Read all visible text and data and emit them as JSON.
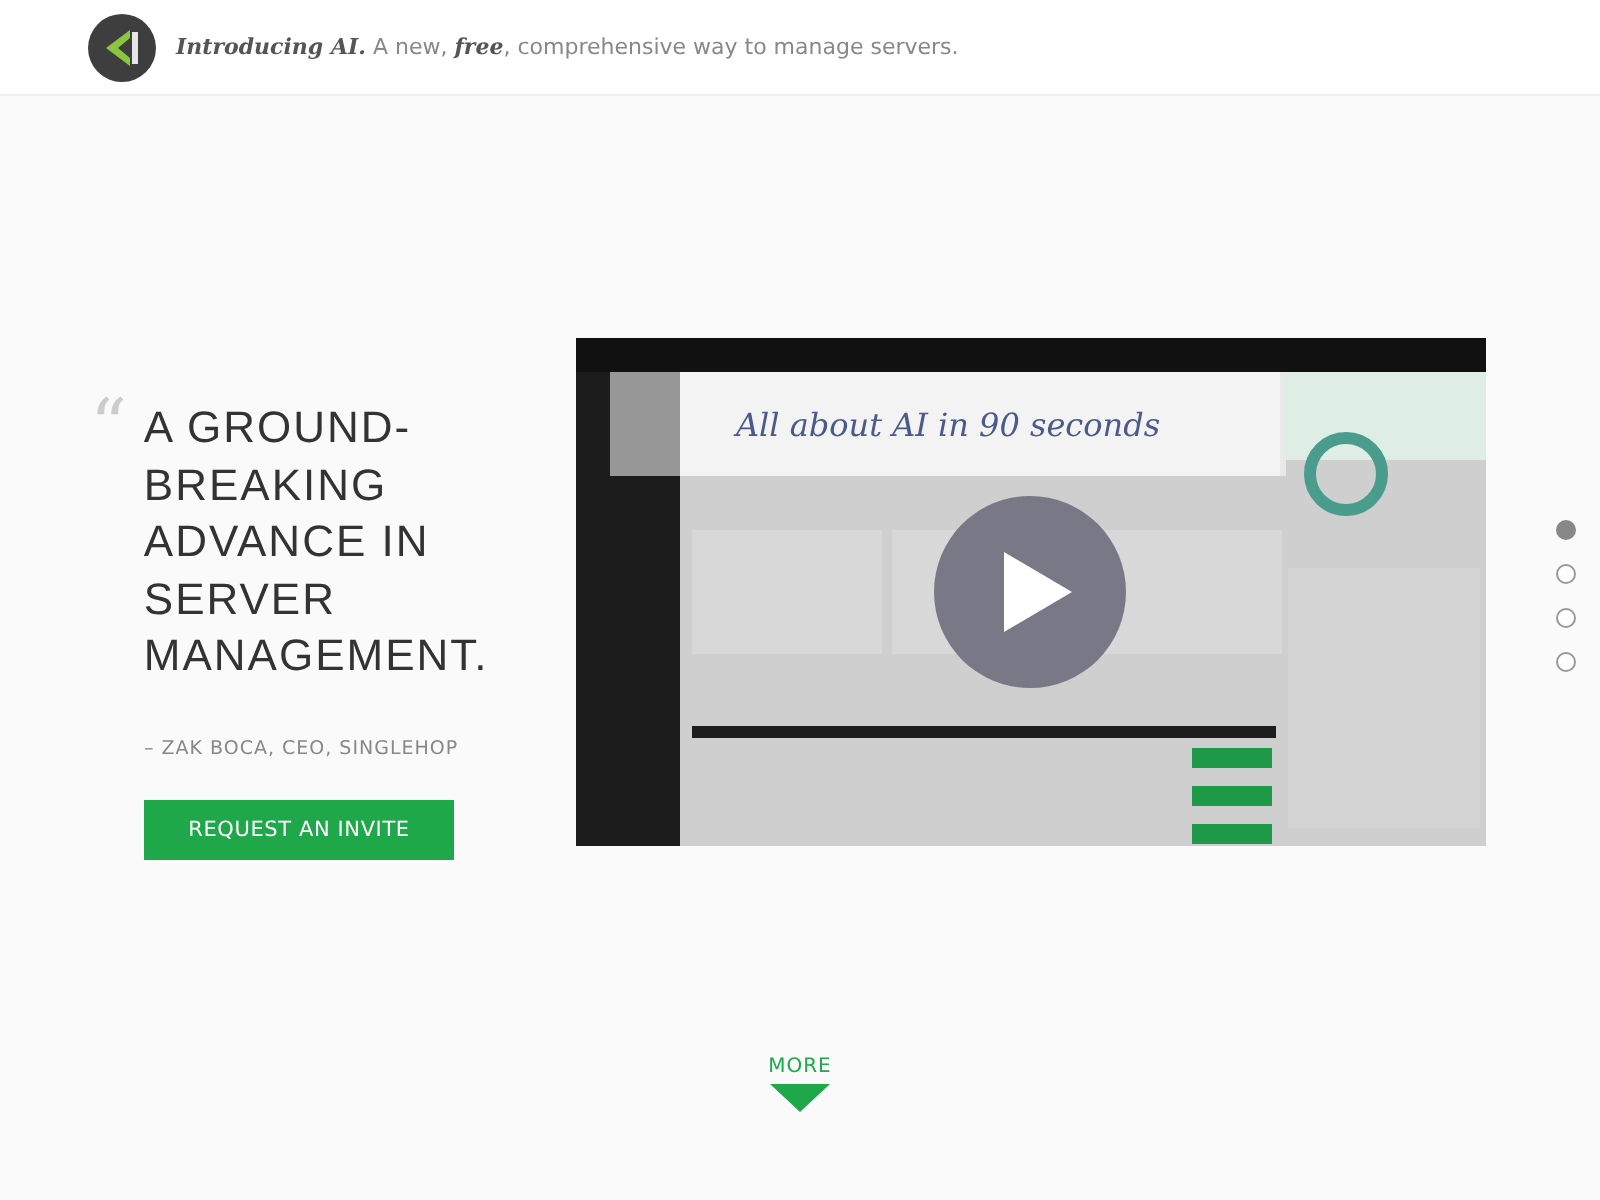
{
  "header": {
    "announcement": "**Introducing AI.** A new, **free**, comprehensive way to manage servers."
  },
  "hero": {
    "quote_mark": "“",
    "headline": "A GROUND-BREAKING ADVANCE IN SERVER MANAGEMENT.",
    "attribution": "– ZAK BOCA, CEO, SINGLEHOP",
    "button": "REQUEST AN INVITE"
  },
  "video": {
    "kind": "picture",
    "title": "All about AI in 90 seconds"
  },
  "slide_dots": [
    {
      "selected": true
    },
    {
      "selected": false
    },
    {
      "selected": false
    },
    {
      "selected": false
    }
  ],
  "more": {
    "label": "MORE"
  }
}
